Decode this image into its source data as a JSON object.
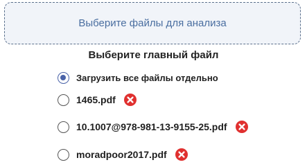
{
  "dropzone": {
    "label": "Выберите файлы для анализа"
  },
  "section": {
    "title": "Выберите главный файл"
  },
  "options": [
    {
      "label": "Загрузить все файлы отдельно",
      "checked": true,
      "removable": false
    },
    {
      "label": "1465.pdf",
      "checked": false,
      "removable": true
    },
    {
      "label": "10.1007@978-981-13-9155-25.pdf",
      "checked": false,
      "removable": true
    },
    {
      "label": "moradpoor2017.pdf",
      "checked": false,
      "removable": true
    }
  ],
  "colors": {
    "accent": "#4a63a8",
    "remove": "#e0302f",
    "dropzone_text": "#4a6ea0"
  },
  "icons": {
    "remove": "close-circle-icon"
  }
}
